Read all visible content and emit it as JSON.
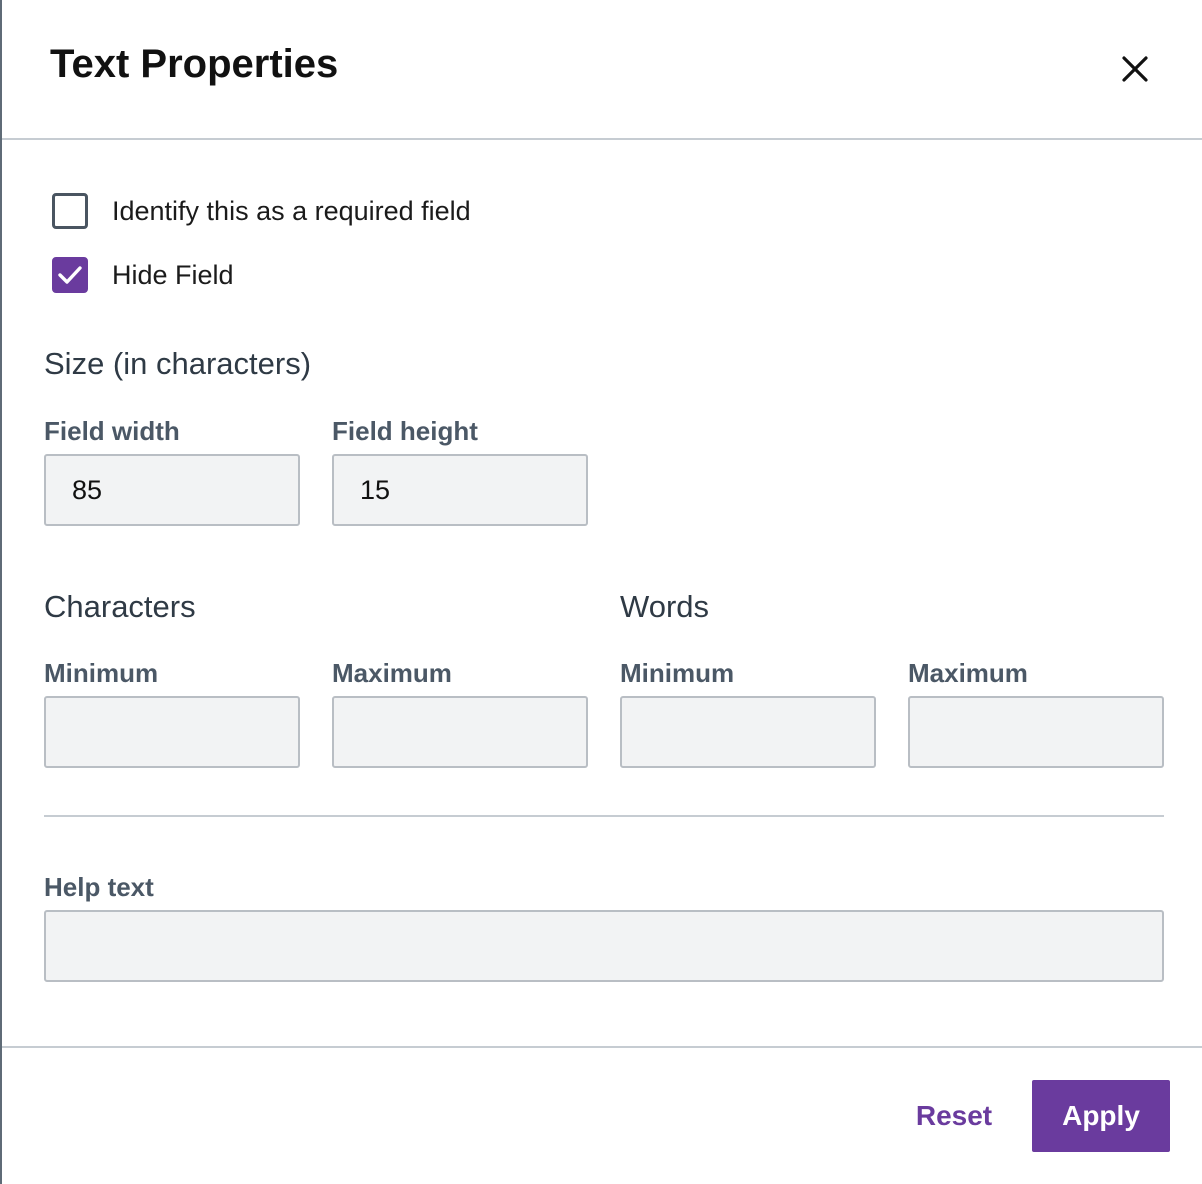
{
  "dialog": {
    "title": "Text Properties",
    "close_icon": "close-icon"
  },
  "options": {
    "required": {
      "label": "Identify this as a required field",
      "checked": false
    },
    "hide": {
      "label": "Hide Field",
      "checked": true
    }
  },
  "size": {
    "section_title": "Size (in characters)",
    "field_width_label": "Field width",
    "field_width_value": "85",
    "field_height_label": "Field height",
    "field_height_value": "15"
  },
  "characters": {
    "section_title": "Characters",
    "min_label": "Minimum",
    "min_value": "",
    "max_label": "Maximum",
    "max_value": ""
  },
  "words": {
    "section_title": "Words",
    "min_label": "Minimum",
    "min_value": "",
    "max_label": "Maximum",
    "max_value": ""
  },
  "help": {
    "label": "Help text",
    "value": ""
  },
  "footer": {
    "reset_label": "Reset",
    "apply_label": "Apply"
  },
  "colors": {
    "accent": "#6a3b9e",
    "input_bg": "#f2f3f4",
    "border": "#b9bec4"
  }
}
